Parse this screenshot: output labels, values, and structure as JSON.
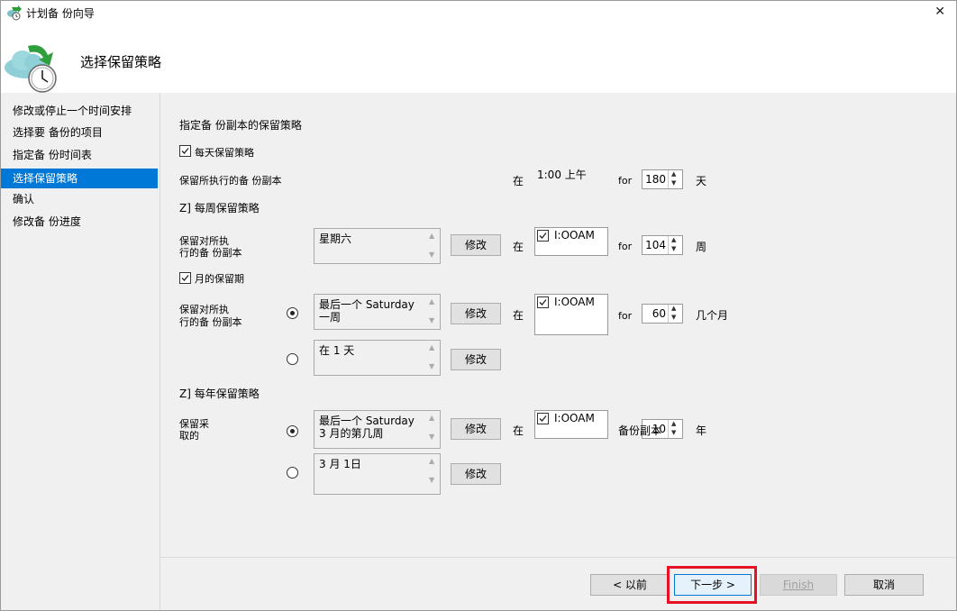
{
  "window": {
    "title": "计划备 份向导",
    "close_glyph": "✕"
  },
  "header": {
    "title": "选择保留策略"
  },
  "sidebar": {
    "items": [
      {
        "label": "修改或停止一个时间安排"
      },
      {
        "label": "选择要 备份的项目"
      },
      {
        "label": "指定备 份时间表"
      },
      {
        "label": "选择保留策略",
        "active": true
      },
      {
        "label": "确认"
      },
      {
        "label": "修改备 份进度"
      }
    ]
  },
  "main": {
    "section_title": "指定备 份副本的保留策略",
    "daily": {
      "checkbox_label": "每天保留策略",
      "checked": true,
      "row_label": "保留所执行的备 份副本",
      "at_label": "在",
      "time": "1:00 上午",
      "for_label": "for",
      "duration": "180",
      "unit": "天"
    },
    "weekly": {
      "title": "Z] 每周保留策略",
      "row_label_1": "保留对所执",
      "row_label_2": "行的备 份副本",
      "days": "星期六",
      "modify_label": "修改",
      "at_label": "在",
      "time": "I:OOAM",
      "time_checked": true,
      "for_label": "for",
      "duration": "104",
      "unit": "周"
    },
    "monthly": {
      "checkbox_label": "月的保留期",
      "checked": true,
      "row_label_1": "保留对所执",
      "row_label_2": "行的备 份副本",
      "option1": {
        "selected": true,
        "line1": "最后一个 Saturday",
        "line2": "一周",
        "modify_label": "修改"
      },
      "option2": {
        "selected": false,
        "line1": "在 1 天",
        "modify_label": "修改"
      },
      "at_label": "在",
      "time": "I:OOAM",
      "time_checked": true,
      "for_label": "for",
      "duration": "60",
      "unit": "几个月"
    },
    "yearly": {
      "title": "Z] 每年保留策略",
      "row_label_1": "保留采",
      "row_label_2": "取的",
      "option1": {
        "selected": true,
        "line1": "最后一个 Saturday",
        "line2": "3 月的第几周",
        "modify_label": "修改"
      },
      "option2": {
        "selected": false,
        "line1": "3 月 1日",
        "modify_label": "修改"
      },
      "at_label": "在",
      "time": "I:OOAM",
      "time_checked": true,
      "backup_copies_label": "备份副本",
      "duration": "10",
      "unit": "年"
    }
  },
  "footer": {
    "back_label": "< 以前",
    "next_label": "下一步 >",
    "finish_label": "Finish",
    "cancel_label": "取消"
  },
  "colors": {
    "accent": "#0078d7",
    "highlight": "#e81123",
    "panel": "#f0f0f0"
  }
}
